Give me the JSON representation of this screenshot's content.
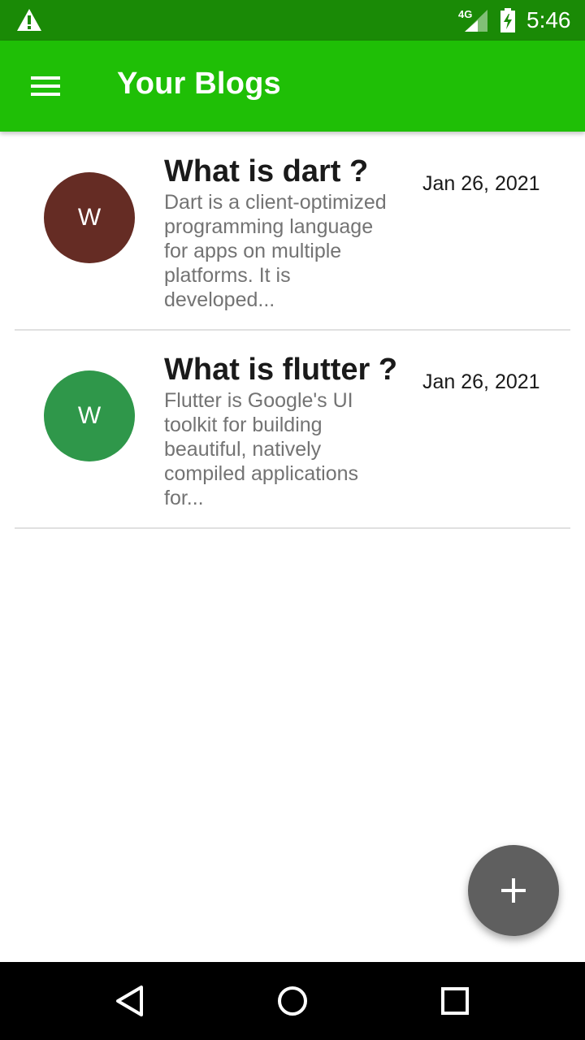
{
  "status_bar": {
    "time": "5:46",
    "network": "4G",
    "icons": [
      "warning-icon",
      "signal-4g-icon",
      "battery-charging-icon"
    ]
  },
  "app_bar": {
    "title": "Your Blogs",
    "menu_icon": "hamburger-menu-icon"
  },
  "blogs": [
    {
      "avatar_letter": "W",
      "avatar_color": "#652c24",
      "title": "What is dart ?",
      "excerpt": "Dart is a client-optimized programming language for apps on multiple platforms. It is developed...",
      "date": "Jan 26, 2021"
    },
    {
      "avatar_letter": "W",
      "avatar_color": "#2f974a",
      "title": "What is flutter ?",
      "excerpt": "Flutter is Google's UI toolkit for building beautiful, natively compiled applications for...",
      "date": "Jan 26, 2021"
    }
  ],
  "fab": {
    "icon": "plus-icon"
  },
  "nav_bar": {
    "icons": [
      "back-icon",
      "home-icon",
      "recents-icon"
    ]
  },
  "colors": {
    "status_bar": "#1a8a06",
    "app_bar": "#1fbf06",
    "fab": "#5f5f5f"
  }
}
